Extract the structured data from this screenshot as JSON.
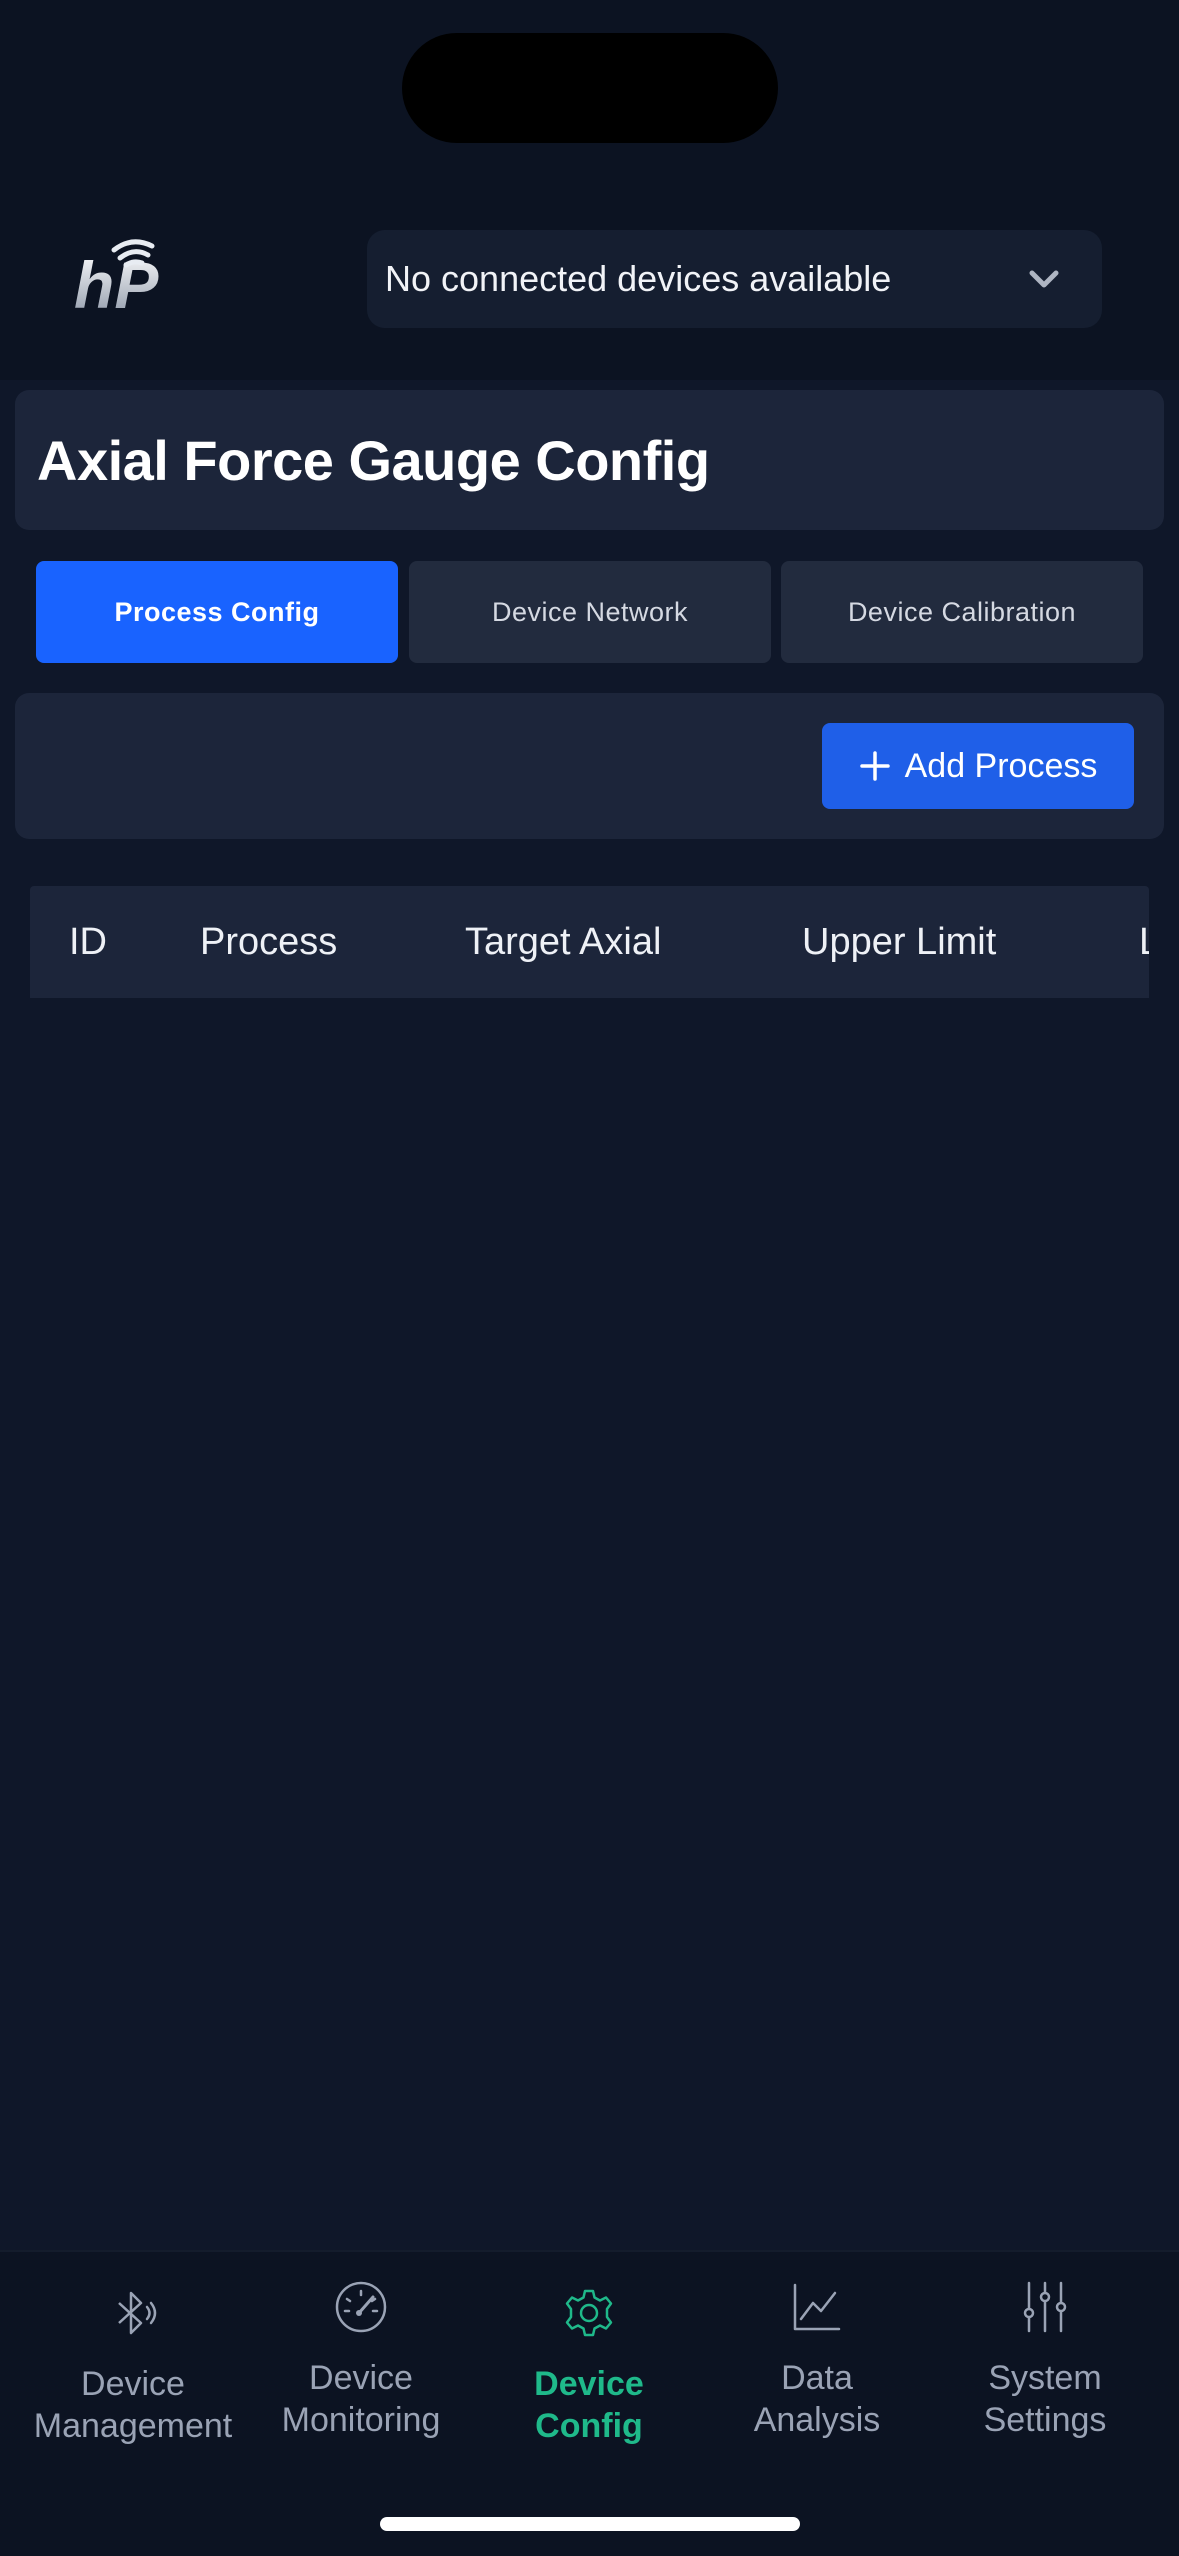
{
  "header": {
    "logo_text": "hP",
    "device_select": {
      "value": "No connected devices available"
    }
  },
  "page": {
    "title": "Axial Force Gauge Config"
  },
  "tabs": [
    {
      "label": "Process Config",
      "active": true
    },
    {
      "label": "Device Network",
      "active": false
    },
    {
      "label": "Device Calibration",
      "active": false
    }
  ],
  "actions": {
    "add_process_label": "Add Process"
  },
  "table": {
    "columns": [
      "ID",
      "Process",
      "Target Axial",
      "Upper Limit",
      "L"
    ]
  },
  "nav": [
    {
      "line1": "Device",
      "line2": "Management",
      "icon": "bluetooth-icon",
      "active": false
    },
    {
      "line1": "Device",
      "line2": "Monitoring",
      "icon": "gauge-icon",
      "active": false
    },
    {
      "line1": "Device",
      "line2": "Config",
      "icon": "gear-icon",
      "active": true
    },
    {
      "line1": "Data",
      "line2": "Analysis",
      "icon": "line-chart-icon",
      "active": false
    },
    {
      "line1": "System",
      "line2": "Settings",
      "icon": "sliders-icon",
      "active": false
    }
  ],
  "colors": {
    "background": "#0f1729",
    "card": "#1c253a",
    "accent_blue": "#1963ff",
    "active_nav": "#1fb98a"
  }
}
